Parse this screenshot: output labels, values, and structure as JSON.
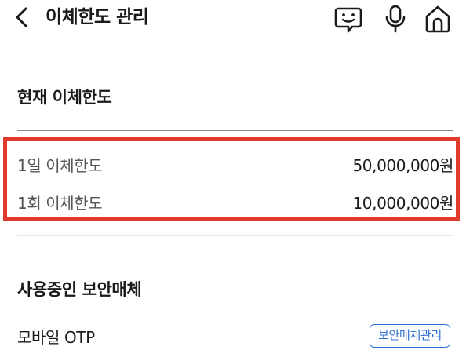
{
  "header": {
    "title": "이체한도 관리",
    "back_icon": "chevron-left-icon",
    "action_icons": [
      "chat-bubble-icon",
      "microphone-icon",
      "home-icon"
    ]
  },
  "current_limit": {
    "section_title": "현재 이체한도",
    "rows": [
      {
        "label": "1일 이체한도",
        "value": "50,000,000원"
      },
      {
        "label": "1회 이체한도",
        "value": "10,000,000원"
      }
    ],
    "highlight_color": "#e03a2f"
  },
  "security_media": {
    "section_title": "사용중인 보안매체",
    "media_name": "모바일 OTP",
    "manage_button_label": "보안매체관리",
    "accent_color": "#2f6fd6"
  }
}
